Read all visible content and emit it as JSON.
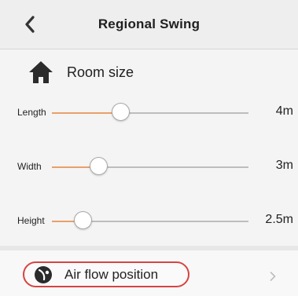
{
  "header": {
    "title": "Regional Swing"
  },
  "room": {
    "section_label": "Room size",
    "icon": "house-icon"
  },
  "sliders": [
    {
      "label": "Length",
      "value": "4m",
      "level": 0.35
    },
    {
      "label": "Width",
      "value": "3m",
      "level": 0.24
    },
    {
      "label": "Height",
      "value": "2.5m",
      "level": 0.16
    }
  ],
  "airflow": {
    "label": "Air flow position",
    "icon": "airflow-icon"
  },
  "colors": {
    "accent_track": "#e8a06a",
    "highlight_border": "#d94242"
  }
}
